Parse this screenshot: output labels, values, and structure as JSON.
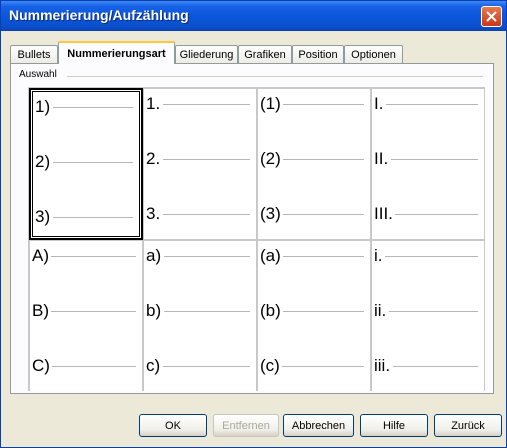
{
  "window": {
    "title": "Nummerierung/Aufzählung"
  },
  "tabs": [
    {
      "label": "Bullets",
      "active": false
    },
    {
      "label": "Nummerierungsart",
      "active": true
    },
    {
      "label": "Gliederung",
      "active": false
    },
    {
      "label": "Grafiken",
      "active": false
    },
    {
      "label": "Position",
      "active": false
    },
    {
      "label": "Optionen",
      "active": false
    }
  ],
  "selection": {
    "group_label": "Auswahl",
    "styles": [
      [
        "1)",
        "2)",
        "3)"
      ],
      [
        "1.",
        "2.",
        "3."
      ],
      [
        "(1)",
        "(2)",
        "(3)"
      ],
      [
        "I.",
        "II.",
        "III."
      ],
      [
        "A)",
        "B)",
        "C)"
      ],
      [
        "a)",
        "b)",
        "c)"
      ],
      [
        "(a)",
        "(b)",
        "(c)"
      ],
      [
        "i.",
        "ii.",
        "iii."
      ]
    ],
    "selected_index": 0
  },
  "buttons": {
    "ok": "OK",
    "remove": "Entfernen",
    "cancel": "Abbrechen",
    "help": "Hilfe",
    "back": "Zurück"
  }
}
